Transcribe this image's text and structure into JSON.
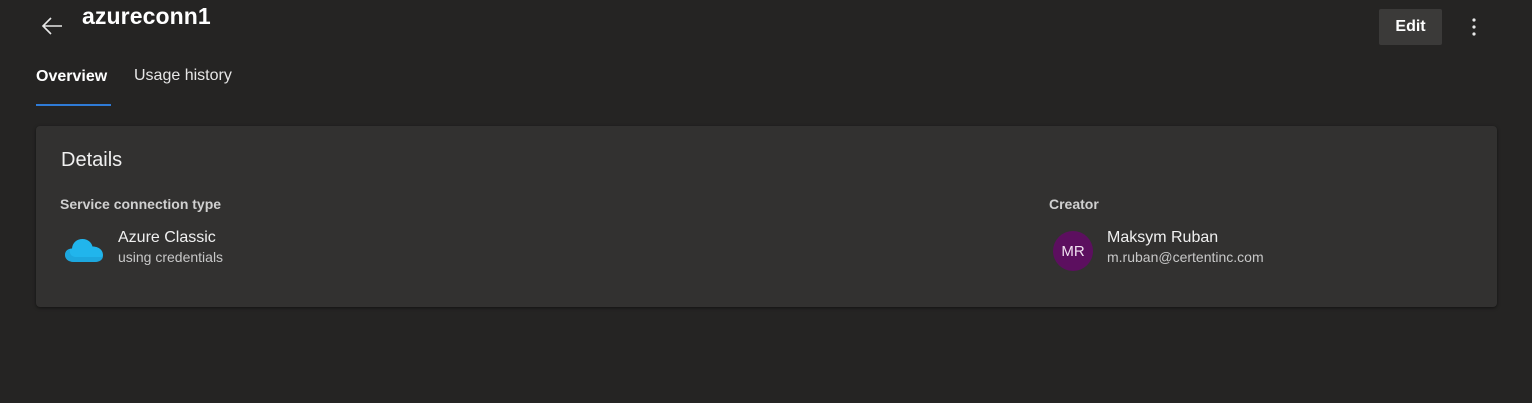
{
  "header": {
    "title": "azureconn1",
    "edit_label": "Edit",
    "back_icon": "arrow-left-icon",
    "more_icon": "more-vertical-icon"
  },
  "tabs": [
    {
      "label": "Overview",
      "selected": true
    },
    {
      "label": "Usage history",
      "selected": false
    }
  ],
  "details": {
    "title": "Details",
    "service_connection": {
      "label": "Service connection type",
      "icon": "azure-cloud-icon",
      "name": "Azure Classic",
      "subtitle": "using credentials"
    },
    "creator": {
      "label": "Creator",
      "initials": "MR",
      "name": "Maksym Ruban",
      "email": "m.ruban@certentinc.com"
    }
  },
  "colors": {
    "background": "#252423",
    "card": "#323130",
    "accent": "#2f7bd6",
    "avatar": "#5c0f5f",
    "cloud": "#21b5ec"
  }
}
